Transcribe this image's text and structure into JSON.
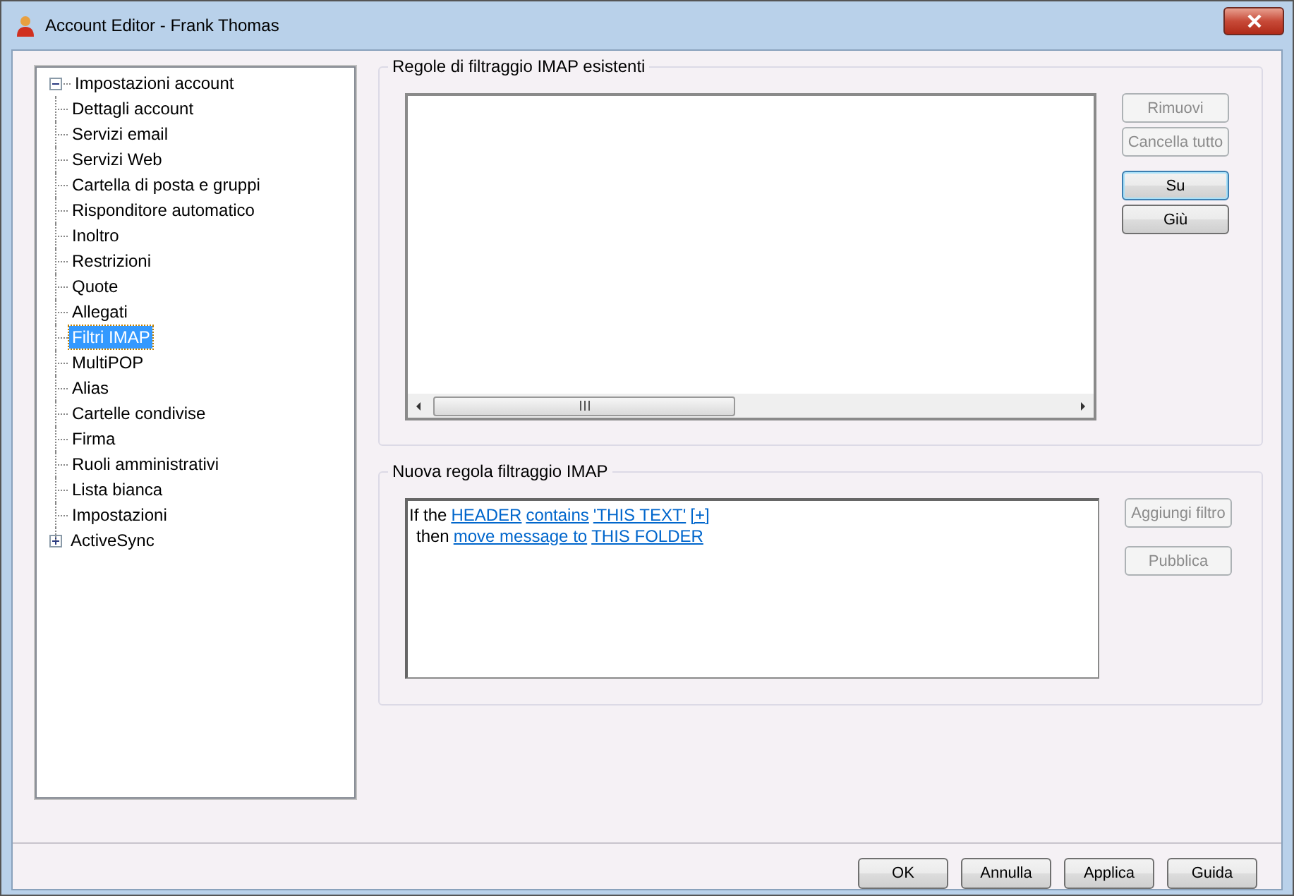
{
  "window": {
    "title": "Account Editor - Frank Thomas"
  },
  "tree": [
    {
      "label": "Impostazioni account",
      "selected": false,
      "expanded": true,
      "children": [
        {
          "label": "Dettagli account",
          "selected": false
        },
        {
          "label": "Servizi email",
          "selected": false
        },
        {
          "label": "Servizi Web",
          "selected": false
        },
        {
          "label": "Cartella di posta e gruppi",
          "selected": false
        },
        {
          "label": "Risponditore automatico",
          "selected": false
        },
        {
          "label": "Inoltro",
          "selected": false
        },
        {
          "label": "Restrizioni",
          "selected": false
        },
        {
          "label": "Quote",
          "selected": false
        },
        {
          "label": "Allegati",
          "selected": false
        },
        {
          "label": "Filtri IMAP",
          "selected": true
        },
        {
          "label": "MultiPOP",
          "selected": false
        },
        {
          "label": "Alias",
          "selected": false
        },
        {
          "label": "Cartelle condivise",
          "selected": false
        },
        {
          "label": "Firma",
          "selected": false
        },
        {
          "label": "Ruoli amministrativi",
          "selected": false
        },
        {
          "label": "Lista bianca",
          "selected": false
        },
        {
          "label": "Impostazioni",
          "selected": false
        },
        {
          "label": "ActiveSync",
          "selected": false,
          "expanded": false
        }
      ]
    }
  ],
  "existing_rules": {
    "title": "Regole di filtraggio IMAP esistenti",
    "buttons": [
      {
        "label": "Rimuovi",
        "disabled": true,
        "focused": false
      },
      {
        "label": "Cancella tutto",
        "disabled": true,
        "focused": false
      },
      {
        "label": "Su",
        "disabled": false,
        "focused": true
      },
      {
        "label": "Giù",
        "disabled": false,
        "focused": false
      }
    ]
  },
  "new_rule": {
    "title": "Nuova regola filtraggio IMAP",
    "lines": [
      [
        {
          "kind": "text",
          "text": "If the"
        },
        {
          "kind": "link",
          "text": "HEADER"
        },
        {
          "kind": "link",
          "text": "contains"
        },
        {
          "kind": "link",
          "text": "'THIS TEXT'"
        },
        {
          "kind": "link",
          "text": "[+]"
        }
      ],
      [
        {
          "kind": "text",
          "text": "then"
        },
        {
          "kind": "link",
          "text": "move message to"
        },
        {
          "kind": "link",
          "text": "THIS FOLDER"
        }
      ]
    ],
    "buttons": [
      {
        "label": "Aggiungi filtro",
        "disabled": true,
        "focused": false
      },
      {
        "label": "Pubblica",
        "disabled": true,
        "focused": false
      }
    ]
  },
  "footer_buttons": [
    "OK",
    "Annulla",
    "Applica",
    "Guida"
  ]
}
